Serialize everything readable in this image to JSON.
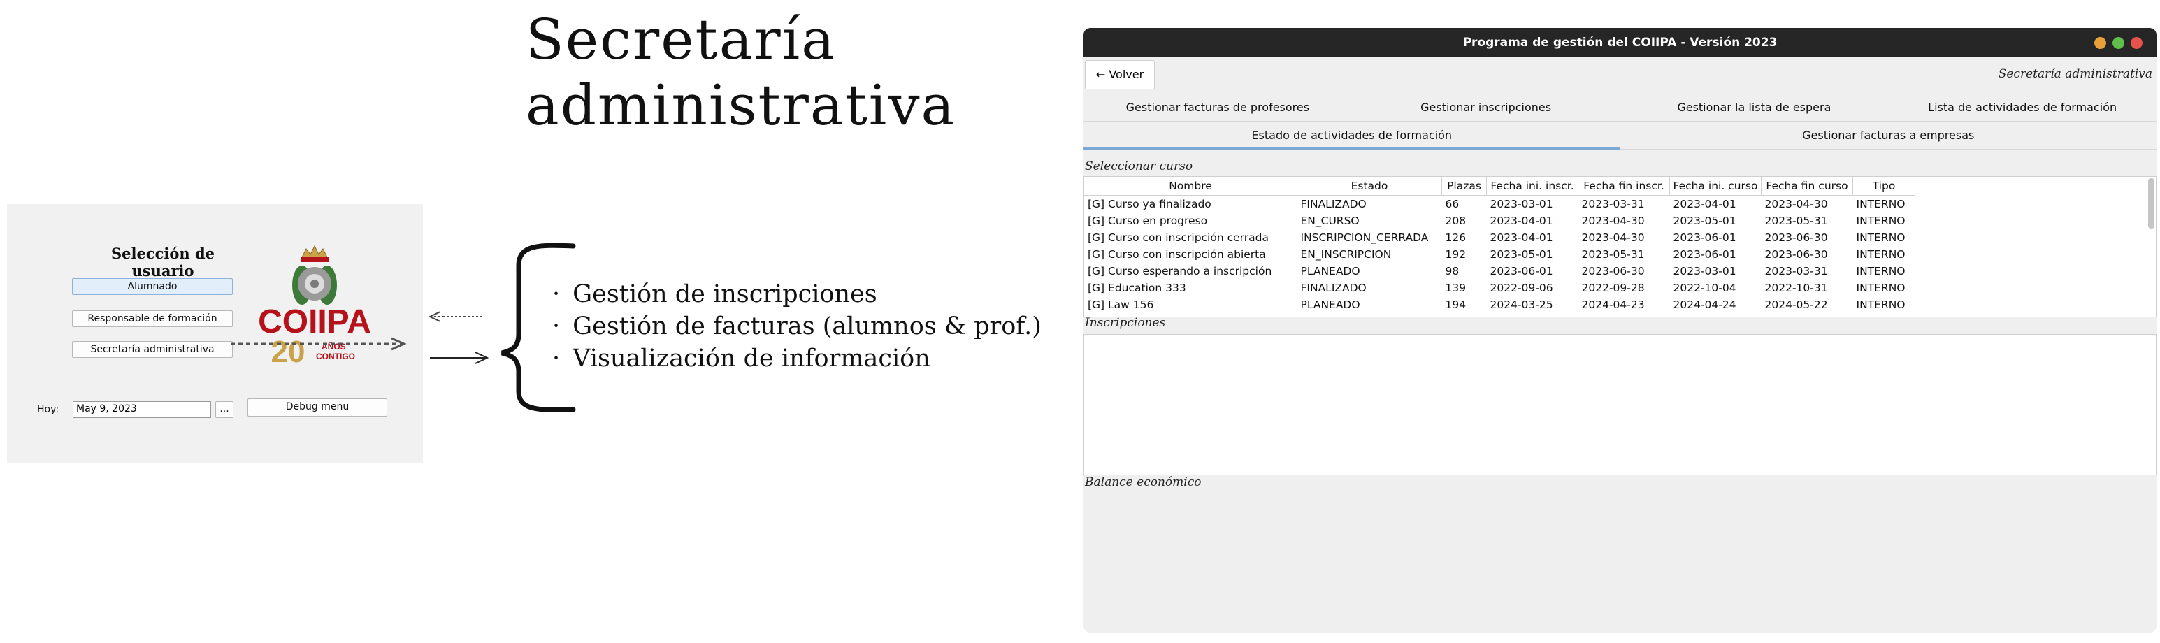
{
  "heading": {
    "line1": "Secretaría",
    "line2": "administrativa"
  },
  "login": {
    "title": "Selección de usuario",
    "buttons": [
      "Alumnado",
      "Responsable de formación",
      "Secretaría administrativa"
    ],
    "today_label": "Hoy:",
    "date_value": "May 9, 2023",
    "date_picker_label": "...",
    "debug_label": "Debug menu",
    "logo_text": "COIIPA",
    "logo_num": "20",
    "logo_sub1": "AÑOS",
    "logo_sub2": "CONTIGO"
  },
  "bullets": [
    "Gestión de inscripciones",
    "Gestión de facturas (alumnos & prof.)",
    "Visualización de información"
  ],
  "app": {
    "title": "Programa de gestión del COIIPA - Versión 2023",
    "back_label": "← Volver",
    "role_label": "Secretaría administrativa",
    "tabs_row1": [
      "Gestionar facturas de profesores",
      "Gestionar inscripciones",
      "Gestionar la lista de espera",
      "Lista de actividades de formación"
    ],
    "tabs_row2": [
      "Estado de actividades de formación",
      "Gestionar facturas a empresas"
    ],
    "select_course_label": "Seleccionar curso",
    "columns": [
      "Nombre",
      "Estado",
      "Plazas",
      "Fecha ini. inscr.",
      "Fecha fin inscr.",
      "Fecha ini. curso",
      "Fecha fin curso",
      "Tipo"
    ],
    "rows": [
      [
        "[G] Curso ya finalizado",
        "FINALIZADO",
        "66",
        "2023-03-01",
        "2023-03-31",
        "2023-04-01",
        "2023-04-30",
        "INTERNO"
      ],
      [
        "[G] Curso en progreso",
        "EN_CURSO",
        "208",
        "2023-04-01",
        "2023-04-30",
        "2023-05-01",
        "2023-05-31",
        "INTERNO"
      ],
      [
        "[G] Curso con inscripción cerrada",
        "INSCRIPCION_CERRADA",
        "126",
        "2023-04-01",
        "2023-04-30",
        "2023-06-01",
        "2023-06-30",
        "INTERNO"
      ],
      [
        "[G] Curso con inscripción abierta",
        "EN_INSCRIPCION",
        "192",
        "2023-05-01",
        "2023-05-31",
        "2023-06-01",
        "2023-06-30",
        "INTERNO"
      ],
      [
        "[G] Curso esperando a inscripción",
        "PLANEADO",
        "98",
        "2023-06-01",
        "2023-06-30",
        "2023-03-01",
        "2023-03-31",
        "INTERNO"
      ],
      [
        "[G] Education 333",
        "FINALIZADO",
        "139",
        "2022-09-06",
        "2022-09-28",
        "2022-10-04",
        "2022-10-31",
        "INTERNO"
      ],
      [
        "[G] Law 156",
        "PLANEADO",
        "194",
        "2024-03-25",
        "2024-04-23",
        "2024-04-24",
        "2024-05-22",
        "INTERNO"
      ]
    ],
    "inscripciones_label": "Inscripciones",
    "balance_label": "Balance económico"
  },
  "colors": {
    "titlebar": "#262626",
    "active_tab": "#7aa9d6",
    "logo_red": "#b5121b",
    "logo_gold": "#c9a24a"
  }
}
